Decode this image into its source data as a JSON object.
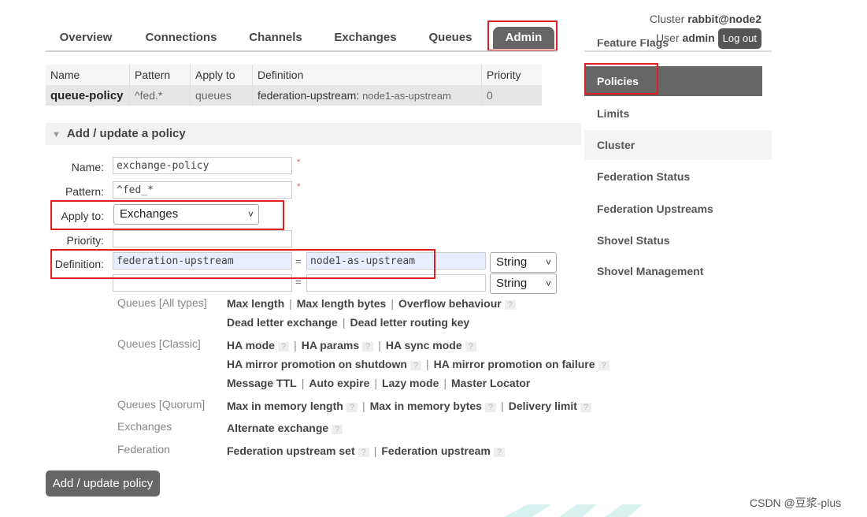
{
  "nav": {
    "tabs": [
      "Overview",
      "Connections",
      "Channels",
      "Exchanges",
      "Queues",
      "Admin"
    ],
    "active": "Admin"
  },
  "header": {
    "cluster_label": "Cluster",
    "cluster_name": "rabbit@node2",
    "user_label": "User",
    "user_name": "admin",
    "logout": "Log out",
    "cropped_item": "Feature Flags"
  },
  "policies_table": {
    "headers": [
      "Name",
      "Pattern",
      "Apply to",
      "Definition",
      "Priority"
    ],
    "row": {
      "name": "queue-policy",
      "pattern": "^fed.*",
      "apply_to": "queues",
      "def_key": "federation-upstream:",
      "def_value": "node1-as-upstream",
      "priority": "0"
    }
  },
  "form": {
    "section_title": "Add / update a policy",
    "name_label": "Name:",
    "name_value": "exchange-policy",
    "pattern_label": "Pattern:",
    "pattern_value": "^fed_*",
    "apply_label": "Apply to:",
    "apply_value": "Exchanges",
    "priority_label": "Priority:",
    "priority_value": "",
    "definition_label": "Definition:",
    "def1_key": "federation-upstream",
    "def1_value": "node1-as-upstream",
    "def1_type": "String",
    "def2_type": "String",
    "equals": "=",
    "required_mark": "*",
    "submit": "Add / update policy"
  },
  "option_groups": {
    "queues_all": {
      "label": "Queues [All types]",
      "line1": [
        "Max length",
        "Max length bytes",
        "Overflow behaviour"
      ],
      "line2": [
        "Dead letter exchange",
        "Dead letter routing key"
      ]
    },
    "queues_classic": {
      "label": "Queues [Classic]",
      "line1": [
        "HA mode",
        "HA params",
        "HA sync mode"
      ],
      "line2": [
        "HA mirror promotion on shutdown",
        "HA mirror promotion on failure"
      ],
      "line3": [
        "Message TTL",
        "Auto expire",
        "Lazy mode",
        "Master Locator"
      ]
    },
    "queues_quorum": {
      "label": "Queues [Quorum]",
      "line1": [
        "Max in memory length",
        "Max in memory bytes",
        "Delivery limit"
      ]
    },
    "exchanges": {
      "label": "Exchanges",
      "line1": [
        "Alternate exchange"
      ]
    },
    "federation": {
      "label": "Federation",
      "line1": [
        "Federation upstream set",
        "Federation upstream"
      ]
    },
    "help": "?",
    "separator": "|"
  },
  "sidebar": {
    "items": [
      "Policies",
      "Limits",
      "Cluster",
      "Federation Status",
      "Federation Upstreams",
      "Shovel Status",
      "Shovel Management"
    ],
    "active": "Policies"
  },
  "watermark": "CSDN @豆浆-plus",
  "colors": {
    "highlight_red": "#e02020",
    "active_bg": "#666666"
  }
}
